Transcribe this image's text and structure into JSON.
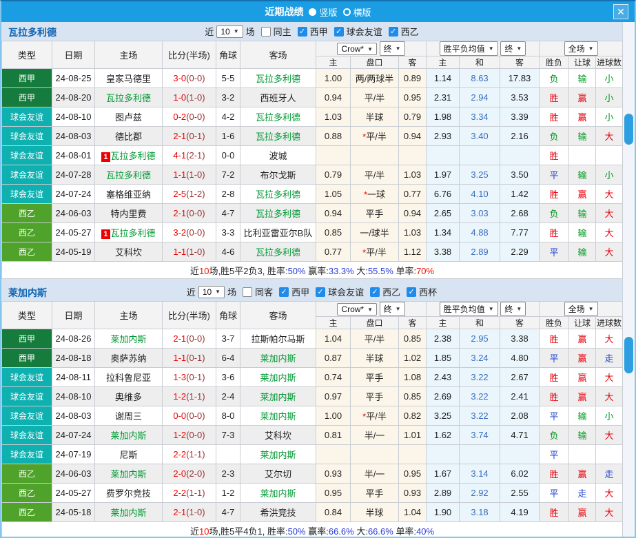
{
  "window": {
    "title": "近期战绩",
    "radio_vertical": "竖版",
    "radio_horizontal": "横版",
    "close_label": "✕"
  },
  "table_header": {
    "left_cols": [
      "类型",
      "日期",
      "主场",
      "比分(半场)",
      "角球",
      "客场"
    ],
    "odds_select": "Crow*",
    "odds_final_select": "终",
    "avg_select": "胜平负均值",
    "avg_final_select": "终",
    "scope_select": "全场",
    "sub_cols": [
      "主",
      "盘口",
      "客",
      "主",
      "和",
      "客",
      "胜负",
      "让球",
      "进球数"
    ]
  },
  "colors": {
    "title_bar": "#1b9de3",
    "laliga_badge": "#157c3d",
    "friendly_badge": "#0fb0b0",
    "segunda_badge": "#4fa32a",
    "focus_team_green": "#009933",
    "score_red": "#f00000",
    "win_red": "#e8000d",
    "draw_blue": "#2244cc",
    "lose_green": "#009922",
    "avg_draw_blue": "#3a6ebf"
  },
  "teams": [
    {
      "name": "瓦拉多利德",
      "filter": {
        "near": "近",
        "count": "10",
        "unit": "场",
        "same_label": "同主",
        "same_checked": false,
        "leagues": [
          {
            "label": "西甲",
            "checked": true
          },
          {
            "label": "球会友谊",
            "checked": true
          },
          {
            "label": "西乙",
            "checked": true
          }
        ]
      },
      "rows": [
        {
          "league": "西甲",
          "lg": "laliga",
          "date": "24-08-25",
          "home": "皇家马德里",
          "home_focus": false,
          "home_card": "",
          "score": "3-0",
          "half": "(0-0)",
          "corner": "5-5",
          "away": "瓦拉多利德",
          "away_focus": true,
          "h": "1.00",
          "hc": "两/两球半",
          "hc_star": false,
          "a": "0.89",
          "m1": "1.14",
          "m2": "8.63",
          "m3": "17.83",
          "r1": "负",
          "r2": "输",
          "r3": "小"
        },
        {
          "league": "西甲",
          "lg": "laliga",
          "date": "24-08-20",
          "home": "瓦拉多利德",
          "home_focus": true,
          "home_card": "",
          "score": "1-0",
          "half": "(1-0)",
          "corner": "3-2",
          "away": "西班牙人",
          "away_focus": false,
          "h": "0.94",
          "hc": "平/半",
          "hc_star": false,
          "a": "0.95",
          "m1": "2.31",
          "m2": "2.94",
          "m3": "3.53",
          "r1": "胜",
          "r2": "赢",
          "r3": "小"
        },
        {
          "league": "球会友谊",
          "lg": "friendly",
          "date": "24-08-10",
          "home": "图卢兹",
          "home_focus": false,
          "home_card": "",
          "score": "0-2",
          "half": "(0-0)",
          "corner": "4-2",
          "away": "瓦拉多利德",
          "away_focus": true,
          "h": "1.03",
          "hc": "半球",
          "hc_star": false,
          "a": "0.79",
          "m1": "1.98",
          "m2": "3.34",
          "m3": "3.39",
          "r1": "胜",
          "r2": "赢",
          "r3": "小"
        },
        {
          "league": "球会友谊",
          "lg": "friendly",
          "date": "24-08-03",
          "home": "德比郡",
          "home_focus": false,
          "home_card": "",
          "score": "2-1",
          "half": "(0-1)",
          "corner": "1-6",
          "away": "瓦拉多利德",
          "away_focus": true,
          "h": "0.88",
          "hc": "平/半",
          "hc_star": true,
          "a": "0.94",
          "m1": "2.93",
          "m2": "3.40",
          "m3": "2.16",
          "r1": "负",
          "r2": "输",
          "r3": "大"
        },
        {
          "league": "球会友谊",
          "lg": "friendly",
          "date": "24-08-01",
          "home": "瓦拉多利德",
          "home_focus": true,
          "home_card": "1",
          "score": "4-1",
          "half": "(2-1)",
          "corner": "0-0",
          "away": "波城",
          "away_focus": false,
          "h": "",
          "hc": "",
          "hc_star": false,
          "a": "",
          "m1": "",
          "m2": "",
          "m3": "",
          "r1": "胜",
          "r2": "",
          "r3": ""
        },
        {
          "league": "球会友谊",
          "lg": "friendly",
          "date": "24-07-28",
          "home": "瓦拉多利德",
          "home_focus": true,
          "home_card": "",
          "score": "1-1",
          "half": "(1-0)",
          "corner": "7-2",
          "away": "布尔戈斯",
          "away_focus": false,
          "h": "0.79",
          "hc": "平/半",
          "hc_star": false,
          "a": "1.03",
          "m1": "1.97",
          "m2": "3.25",
          "m3": "3.50",
          "r1": "平",
          "r2": "输",
          "r3": "小"
        },
        {
          "league": "球会友谊",
          "lg": "friendly",
          "date": "24-07-24",
          "home": "塞格维亚纳",
          "home_focus": false,
          "home_card": "",
          "score": "2-5",
          "half": "(1-2)",
          "corner": "2-8",
          "away": "瓦拉多利德",
          "away_focus": true,
          "h": "1.05",
          "hc": "一球",
          "hc_star": true,
          "a": "0.77",
          "m1": "6.76",
          "m2": "4.10",
          "m3": "1.42",
          "r1": "胜",
          "r2": "赢",
          "r3": "大"
        },
        {
          "league": "西乙",
          "lg": "segunda",
          "date": "24-06-03",
          "home": "特内里费",
          "home_focus": false,
          "home_card": "",
          "score": "2-1",
          "half": "(0-0)",
          "corner": "4-7",
          "away": "瓦拉多利德",
          "away_focus": true,
          "h": "0.94",
          "hc": "平手",
          "hc_star": false,
          "a": "0.94",
          "m1": "2.65",
          "m2": "3.03",
          "m3": "2.68",
          "r1": "负",
          "r2": "输",
          "r3": "大"
        },
        {
          "league": "西乙",
          "lg": "segunda",
          "date": "24-05-27",
          "home": "瓦拉多利德",
          "home_focus": true,
          "home_card": "1",
          "score": "3-2",
          "half": "(0-0)",
          "corner": "3-3",
          "away": "比利亚雷亚尔B队",
          "away_focus": false,
          "h": "0.85",
          "hc": "一/球半",
          "hc_star": false,
          "a": "1.03",
          "m1": "1.34",
          "m2": "4.88",
          "m3": "7.77",
          "r1": "胜",
          "r2": "输",
          "r3": "大"
        },
        {
          "league": "西乙",
          "lg": "segunda",
          "date": "24-05-19",
          "home": "艾科坎",
          "home_focus": false,
          "home_card": "",
          "score": "1-1",
          "half": "(1-0)",
          "corner": "4-6",
          "away": "瓦拉多利德",
          "away_focus": true,
          "h": "0.77",
          "hc": "平/半",
          "hc_star": true,
          "a": "1.12",
          "m1": "3.38",
          "m2": "2.89",
          "m3": "2.29",
          "r1": "平",
          "r2": "输",
          "r3": "大"
        }
      ],
      "summary": [
        {
          "t": "近",
          "c": "k"
        },
        {
          "t": "10",
          "c": "r"
        },
        {
          "t": "场,胜5平2负3, 胜率:",
          "c": "k"
        },
        {
          "t": "50%",
          "c": "b"
        },
        {
          "t": " 赢率:",
          "c": "k"
        },
        {
          "t": "33.3%",
          "c": "b"
        },
        {
          "t": " 大:",
          "c": "k"
        },
        {
          "t": "55.5%",
          "c": "b"
        },
        {
          "t": " 单率:",
          "c": "k"
        },
        {
          "t": "70%",
          "c": "r"
        }
      ]
    },
    {
      "name": "莱加内斯",
      "filter": {
        "near": "近",
        "count": "10",
        "unit": "场",
        "same_label": "同客",
        "same_checked": false,
        "leagues": [
          {
            "label": "西甲",
            "checked": true
          },
          {
            "label": "球会友谊",
            "checked": true
          },
          {
            "label": "西乙",
            "checked": true
          },
          {
            "label": "西杯",
            "checked": true
          }
        ]
      },
      "rows": [
        {
          "league": "西甲",
          "lg": "laliga",
          "date": "24-08-26",
          "home": "莱加内斯",
          "home_focus": true,
          "home_card": "",
          "score": "2-1",
          "half": "(0-0)",
          "corner": "3-7",
          "away": "拉斯帕尔马斯",
          "away_focus": false,
          "h": "1.04",
          "hc": "平/半",
          "hc_star": false,
          "a": "0.85",
          "m1": "2.38",
          "m2": "2.95",
          "m3": "3.38",
          "r1": "胜",
          "r2": "赢",
          "r3": "大"
        },
        {
          "league": "西甲",
          "lg": "laliga",
          "date": "24-08-18",
          "home": "奥萨苏纳",
          "home_focus": false,
          "home_card": "",
          "score": "1-1",
          "half": "(0-1)",
          "corner": "6-4",
          "away": "莱加内斯",
          "away_focus": true,
          "h": "0.87",
          "hc": "半球",
          "hc_star": false,
          "a": "1.02",
          "m1": "1.85",
          "m2": "3.24",
          "m3": "4.80",
          "r1": "平",
          "r2": "赢",
          "r3": "走"
        },
        {
          "league": "球会友谊",
          "lg": "friendly",
          "date": "24-08-11",
          "home": "拉科鲁尼亚",
          "home_focus": false,
          "home_card": "",
          "score": "1-3",
          "half": "(0-1)",
          "corner": "3-6",
          "away": "莱加内斯",
          "away_focus": true,
          "h": "0.74",
          "hc": "平手",
          "hc_star": false,
          "a": "1.08",
          "m1": "2.43",
          "m2": "3.22",
          "m3": "2.67",
          "r1": "胜",
          "r2": "赢",
          "r3": "大"
        },
        {
          "league": "球会友谊",
          "lg": "friendly",
          "date": "24-08-10",
          "home": "奥维多",
          "home_focus": false,
          "home_card": "",
          "score": "1-2",
          "half": "(1-1)",
          "corner": "2-4",
          "away": "莱加内斯",
          "away_focus": true,
          "h": "0.97",
          "hc": "平手",
          "hc_star": false,
          "a": "0.85",
          "m1": "2.69",
          "m2": "3.22",
          "m3": "2.41",
          "r1": "胜",
          "r2": "赢",
          "r3": "大"
        },
        {
          "league": "球会友谊",
          "lg": "friendly",
          "date": "24-08-03",
          "home": "谢周三",
          "home_focus": false,
          "home_card": "",
          "score": "0-0",
          "half": "(0-0)",
          "corner": "8-0",
          "away": "莱加内斯",
          "away_focus": true,
          "h": "1.00",
          "hc": "平/半",
          "hc_star": true,
          "a": "0.82",
          "m1": "3.25",
          "m2": "3.22",
          "m3": "2.08",
          "r1": "平",
          "r2": "输",
          "r3": "小"
        },
        {
          "league": "球会友谊",
          "lg": "friendly",
          "date": "24-07-24",
          "home": "莱加内斯",
          "home_focus": true,
          "home_card": "",
          "score": "1-2",
          "half": "(0-0)",
          "corner": "7-3",
          "away": "艾科坎",
          "away_focus": false,
          "h": "0.81",
          "hc": "半/一",
          "hc_star": false,
          "a": "1.01",
          "m1": "1.62",
          "m2": "3.74",
          "m3": "4.71",
          "r1": "负",
          "r2": "输",
          "r3": "大"
        },
        {
          "league": "球会友谊",
          "lg": "friendly",
          "date": "24-07-19",
          "home": "尼斯",
          "home_focus": false,
          "home_card": "",
          "score": "2-2",
          "half": "(1-1)",
          "corner": "",
          "away": "莱加内斯",
          "away_focus": true,
          "h": "",
          "hc": "",
          "hc_star": false,
          "a": "",
          "m1": "",
          "m2": "",
          "m3": "",
          "r1": "平",
          "r2": "",
          "r3": ""
        },
        {
          "league": "西乙",
          "lg": "segunda",
          "date": "24-06-03",
          "home": "莱加内斯",
          "home_focus": true,
          "home_card": "",
          "score": "2-0",
          "half": "(2-0)",
          "corner": "2-3",
          "away": "艾尔切",
          "away_focus": false,
          "h": "0.93",
          "hc": "半/一",
          "hc_star": false,
          "a": "0.95",
          "m1": "1.67",
          "m2": "3.14",
          "m3": "6.02",
          "r1": "胜",
          "r2": "赢",
          "r3": "走"
        },
        {
          "league": "西乙",
          "lg": "segunda",
          "date": "24-05-27",
          "home": "费罗尔竞技",
          "home_focus": false,
          "home_card": "",
          "score": "2-2",
          "half": "(1-1)",
          "corner": "1-2",
          "away": "莱加内斯",
          "away_focus": true,
          "h": "0.95",
          "hc": "平手",
          "hc_star": false,
          "a": "0.93",
          "m1": "2.89",
          "m2": "2.92",
          "m3": "2.55",
          "r1": "平",
          "r2": "走",
          "r3": "大"
        },
        {
          "league": "西乙",
          "lg": "segunda",
          "date": "24-05-18",
          "home": "莱加内斯",
          "home_focus": true,
          "home_card": "",
          "score": "2-1",
          "half": "(1-0)",
          "corner": "4-7",
          "away": "希洪竞技",
          "away_focus": false,
          "h": "0.84",
          "hc": "半球",
          "hc_star": false,
          "a": "1.04",
          "m1": "1.90",
          "m2": "3.18",
          "m3": "4.19",
          "r1": "胜",
          "r2": "赢",
          "r3": "大"
        }
      ],
      "summary": [
        {
          "t": "近",
          "c": "k"
        },
        {
          "t": "10",
          "c": "r"
        },
        {
          "t": "场,胜5平4负1, 胜率:",
          "c": "k"
        },
        {
          "t": "50%",
          "c": "b"
        },
        {
          "t": " 赢率:",
          "c": "k"
        },
        {
          "t": "66.6%",
          "c": "b"
        },
        {
          "t": " 大:",
          "c": "k"
        },
        {
          "t": "66.6%",
          "c": "b"
        },
        {
          "t": " 单率:",
          "c": "k"
        },
        {
          "t": "40%",
          "c": "b"
        }
      ]
    }
  ]
}
